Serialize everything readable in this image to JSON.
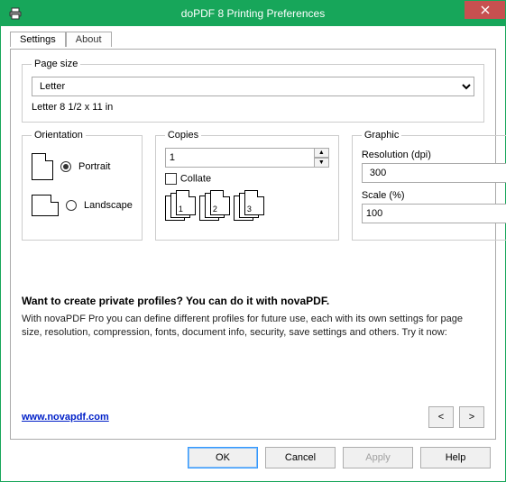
{
  "window": {
    "title": "doPDF 8 Printing Preferences"
  },
  "tabs": {
    "settings": "Settings",
    "about": "About"
  },
  "page_size": {
    "legend": "Page size",
    "selected": "Letter",
    "dimensions": "Letter 8 1/2 x 11 in"
  },
  "orientation": {
    "legend": "Orientation",
    "portrait": "Portrait",
    "landscape": "Landscape",
    "selected": "portrait"
  },
  "copies": {
    "legend": "Copies",
    "count": "1",
    "collate_label": "Collate",
    "stack_labels": [
      "1",
      "2",
      "3"
    ]
  },
  "graphic": {
    "legend": "Graphic",
    "resolution_label": "Resolution (dpi)",
    "resolution_value": "300",
    "scale_label": "Scale (%)",
    "scale_value": "100"
  },
  "promo": {
    "heading": "Want to create private profiles? You can do it with novaPDF.",
    "body": "With novaPDF Pro you can define different profiles for future use, each with its own settings for page size, resolution, compression, fonts, document info, security, save settings and others. Try it now:",
    "link_text": "www.novapdf.com",
    "prev": "<",
    "next": ">"
  },
  "buttons": {
    "ok": "OK",
    "cancel": "Cancel",
    "apply": "Apply",
    "help": "Help"
  }
}
